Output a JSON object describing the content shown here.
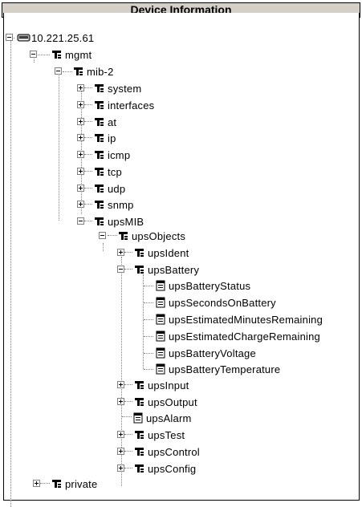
{
  "header": {
    "title": "Device Information"
  },
  "tree": {
    "root": "10.221.25.61",
    "mgmt": "mgmt",
    "mib2": "mib-2",
    "system": "system",
    "interfaces": "interfaces",
    "at": "at",
    "ip": "ip",
    "icmp": "icmp",
    "tcp": "tcp",
    "udp": "udp",
    "snmp": "snmp",
    "upsMIB": "upsMIB",
    "upsObjects": "upsObjects",
    "upsIdent": "upsIdent",
    "upsBattery": "upsBattery",
    "upsBatteryStatus": "upsBatteryStatus",
    "upsSecondsOnBattery": "upsSecondsOnBattery",
    "upsEstimatedMinutesRemaining": "upsEstimatedMinutesRemaining",
    "upsEstimatedChargeRemaining": "upsEstimatedChargeRemaining",
    "upsBatteryVoltage": "upsBatteryVoltage",
    "upsBatteryTemperature": "upsBatteryTemperature",
    "upsInput": "upsInput",
    "upsOutput": "upsOutput",
    "upsAlarm": "upsAlarm",
    "upsTest": "upsTest",
    "upsControl": "upsControl",
    "upsConfig": "upsConfig",
    "private": "private"
  },
  "icons": {
    "device": "device-icon",
    "folder": "mib-folder-icon",
    "leaf": "mib-leaf-icon"
  }
}
